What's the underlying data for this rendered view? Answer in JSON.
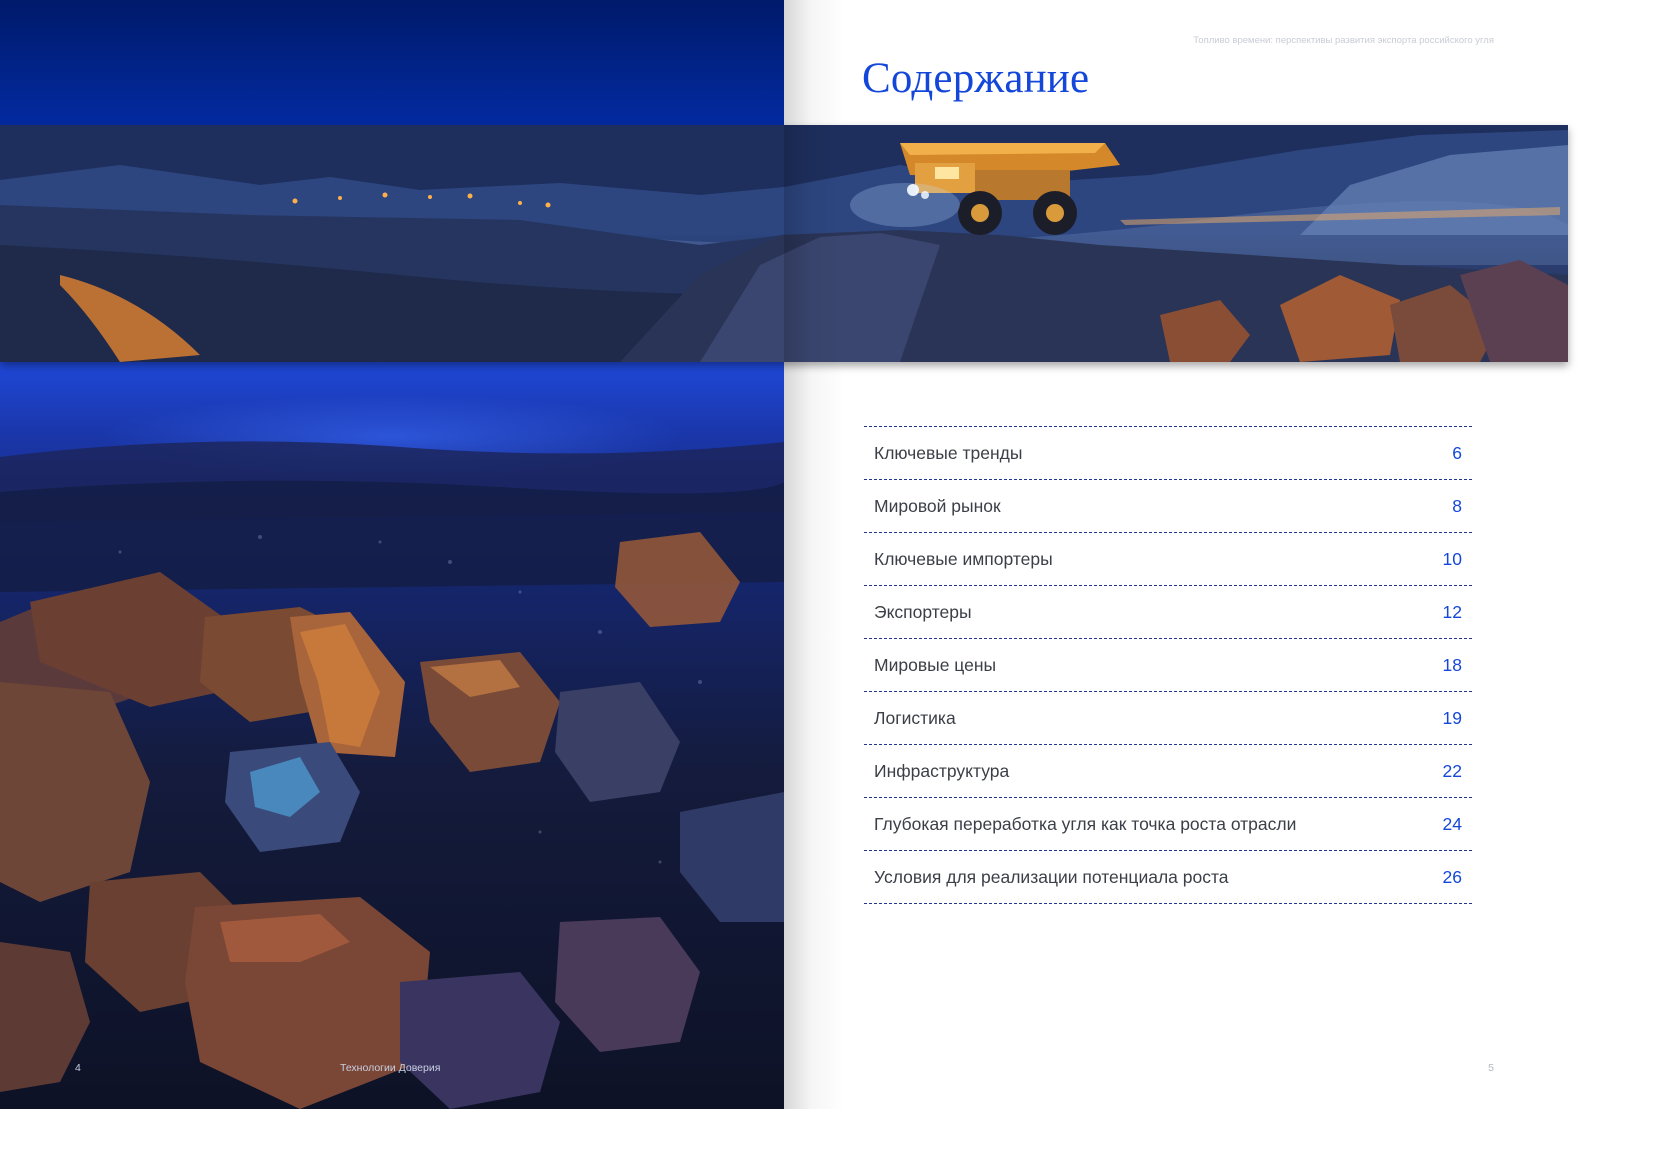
{
  "header": {
    "running_title": "Топливо времени: перспективы развития экспорта российского угля",
    "page_title": "Содержание"
  },
  "toc": {
    "items": [
      {
        "label": "Ключевые тренды",
        "page": "6"
      },
      {
        "label": "Мировой рынок",
        "page": "8"
      },
      {
        "label": "Ключевые импортеры",
        "page": "10"
      },
      {
        "label": "Экспортеры",
        "page": "12"
      },
      {
        "label": "Мировые цены",
        "page": "18"
      },
      {
        "label": "Логистика",
        "page": "19"
      },
      {
        "label": "Инфраструктура",
        "page": "22"
      },
      {
        "label": "Глубокая переработка угля как точка роста отрасли",
        "page": "24"
      },
      {
        "label": "Условия для реализации потенциала роста",
        "page": "26"
      }
    ]
  },
  "footer": {
    "left_page_number": "4",
    "brand": "Технологии Доверия",
    "right_page_number": "5"
  },
  "colors": {
    "accent_blue": "#1447d9",
    "rule_navy": "#23358f",
    "body_text": "#3b3f47"
  }
}
